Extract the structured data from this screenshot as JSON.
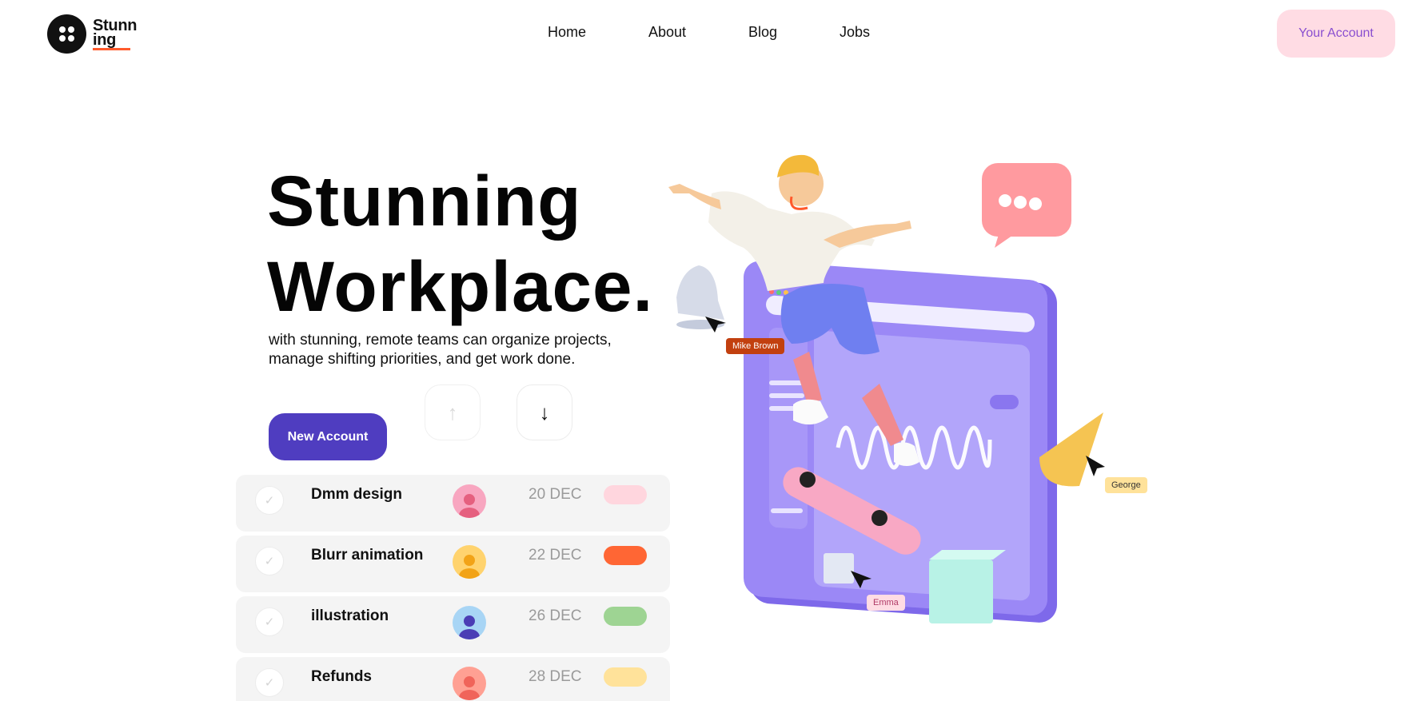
{
  "header": {
    "logo_line1": "Stunn",
    "logo_line2": "ing",
    "nav": [
      "Home",
      "About",
      "Blog",
      "Jobs"
    ],
    "account_button": "Your Account"
  },
  "hero": {
    "title_line1": "Stunning",
    "title_line2": "Workplace.",
    "subtitle_line1": "with stunning, remote teams can organize projects,",
    "subtitle_line2": "manage shifting priorities, and get work done.",
    "cta_label": "New Account",
    "arrow_up_icon": "arrow-up-icon",
    "arrow_down_icon": "arrow-down-icon"
  },
  "tasks": [
    {
      "name": "Dmm design",
      "date": "20 DEC",
      "avatar_color": "#f8a6c0",
      "avatar_figure": "#e5607f",
      "status_color": "#ffd6de"
    },
    {
      "name": "Blurr animation",
      "date": "22 DEC",
      "avatar_color": "#ffd36e",
      "avatar_figure": "#f2a317",
      "status_color": "#ff6634"
    },
    {
      "name": "illustration",
      "date": "26 DEC",
      "avatar_color": "#a8d5f5",
      "avatar_figure": "#4b3db5",
      "status_color": "#9ed493"
    },
    {
      "name": "Refunds",
      "date": "28 DEC",
      "avatar_color": "#ffa093",
      "avatar_figure": "#f0645a",
      "status_color": "#ffe29a"
    }
  ],
  "illustration": {
    "tags": [
      "Mike Brown",
      "George",
      "Emma"
    ]
  },
  "colors": {
    "accent": "#4f3dc0",
    "account_bg": "#ffdce4",
    "account_text": "#8a4fd0",
    "logo_underline": "#ff5a2c",
    "screen": "#8e7bf2"
  }
}
